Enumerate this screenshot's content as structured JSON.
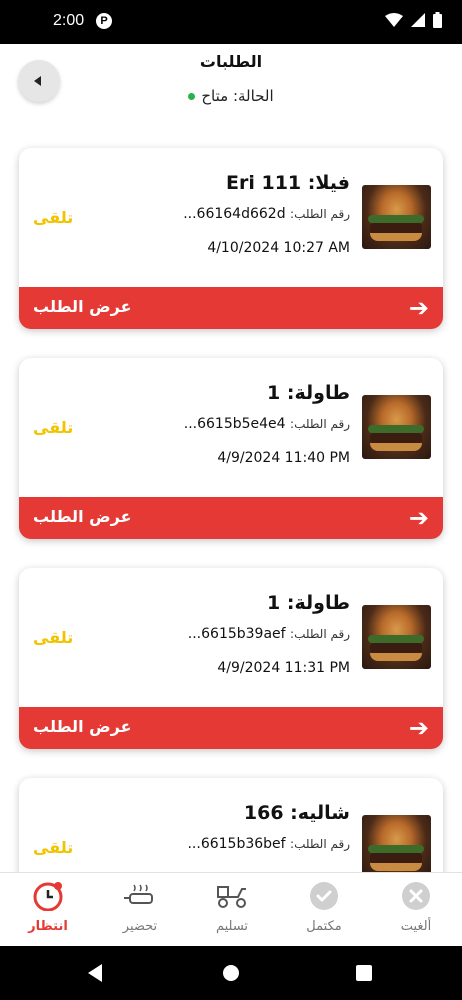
{
  "statusbar": {
    "time": "2:00",
    "app_icon": "p-badge-icon"
  },
  "header": {
    "title": "الطلبات",
    "status_label": "الحالة: متاح",
    "status_color": "#28b347"
  },
  "orders": [
    {
      "title": "فيلا: Eri 111",
      "order_no_label": "رقم الطلب:",
      "order_no": "66164d662d...",
      "date": "4/10/2024 10:27 AM",
      "state": "تلقى",
      "view_label": "عرض الطلب"
    },
    {
      "title": "طاولة: 1",
      "order_no_label": "رقم الطلب:",
      "order_no": "6615b5e4e4...",
      "date": "4/9/2024 11:40 PM",
      "state": "تلقى",
      "view_label": "عرض الطلب"
    },
    {
      "title": "طاولة: 1",
      "order_no_label": "رقم الطلب:",
      "order_no": "6615b39aef...",
      "date": "4/9/2024 11:31 PM",
      "state": "تلقى",
      "view_label": "عرض الطلب"
    },
    {
      "title": "شاليه: 166",
      "order_no_label": "رقم الطلب:",
      "order_no": "6615b36bef...",
      "date": "",
      "state": "تلقى",
      "view_label": ""
    }
  ],
  "tabs": [
    {
      "label": "ألغيت",
      "icon": "cancel-icon",
      "active": false
    },
    {
      "label": "مكتمل",
      "icon": "check-circle-icon",
      "active": false
    },
    {
      "label": "تسليم",
      "icon": "delivery-scooter-icon",
      "active": false
    },
    {
      "label": "تحضير",
      "icon": "cooking-pan-icon",
      "active": false
    },
    {
      "label": "انتظار",
      "icon": "clock-icon",
      "active": true
    }
  ],
  "colors": {
    "accent": "#e53935",
    "state": "#f2c400"
  }
}
